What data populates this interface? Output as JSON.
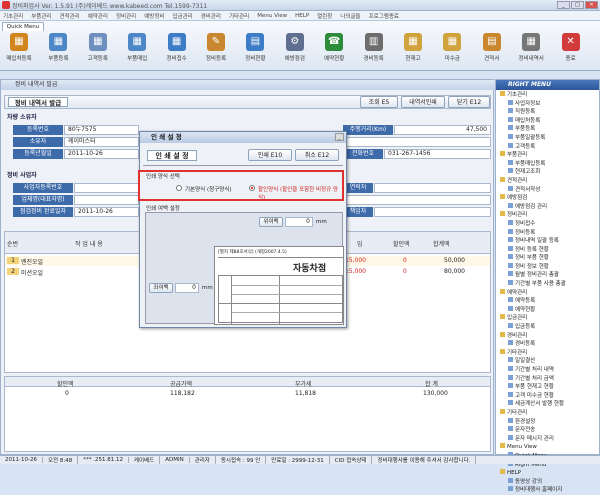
{
  "app": {
    "title": "정비파업사 Ver. 1.5.91  (주)케이베드 www.kabeed.com  Tel.1599-7311"
  },
  "menubar": [
    "기초관리",
    "부품관리",
    "견적관리",
    "예약관리",
    "정비관리",
    "예방정비",
    "입금관리",
    "경비관리",
    "기타관리",
    "Menu View",
    "HELP",
    "열린창",
    "나의글들",
    "프로그램종료"
  ],
  "quick_menu": {
    "tab": "Quick Menu",
    "tools": [
      {
        "label": "매입처등록",
        "color": "#d0851f",
        "icon": "▦"
      },
      {
        "label": "부품등록",
        "color": "#4d87c7",
        "icon": "▦"
      },
      {
        "label": "고객등록",
        "color": "#6f8fbf",
        "icon": "▦"
      },
      {
        "label": "부품매입",
        "color": "#4d87c7",
        "icon": "▦"
      },
      {
        "label": "정비접수",
        "color": "#3d7cc6",
        "icon": "▦"
      },
      {
        "label": "정비등록",
        "color": "#c9882f",
        "icon": "✎"
      },
      {
        "label": "정비현황",
        "color": "#3d7cc6",
        "icon": "▤"
      },
      {
        "label": "예방점검",
        "color": "#5f6f8f",
        "icon": "⚙"
      },
      {
        "label": "예약현황",
        "color": "#2d8c3a",
        "icon": "☎"
      },
      {
        "label": "경비등록",
        "color": "#6d6d6d",
        "icon": "▥"
      },
      {
        "label": "현재고",
        "color": "#d0a33f",
        "icon": "▦"
      },
      {
        "label": "미수금",
        "color": "#d0a33f",
        "icon": "▦"
      },
      {
        "label": "견적서",
        "color": "#c9882f",
        "icon": "▤"
      },
      {
        "label": "정비내역서",
        "color": "#777777",
        "icon": "▦"
      },
      {
        "label": "종료",
        "color": "#d23b3b",
        "icon": "✕"
      }
    ]
  },
  "panel": {
    "title": "정비 내역서 발급",
    "heading": "정비 내역서 발급",
    "btn_search": "조회 E5",
    "btn_print": "내역서인쇄",
    "btn_close": "닫기 E12"
  },
  "owner": {
    "section": "차량 소유자",
    "reg_label": "등록번호",
    "reg_value": "80누7575",
    "owner_label": "소유자",
    "owner_value": "케이마스터",
    "date_label": "등록년월일",
    "date_value": "2011-10-26",
    "mileage_label": "주행거리(Km)",
    "mileage_value": "47,500",
    "tel_label": "전화번호",
    "tel_value": "031-267-1456"
  },
  "biz": {
    "section": "정비 사업자",
    "bizno_label": "사업자등록번호",
    "ceo_label": "업체명(대표자명)",
    "done_label": "점검정비 완료일자",
    "done_value": "2011-10-26",
    "phone_label": "연락처",
    "resp_label": "책임자"
  },
  "table": {
    "headers": [
      "순번",
      "작 업 내 용",
      "",
      "임",
      "할인액",
      "합계액"
    ],
    "rows": [
      {
        "no": "1",
        "work": "엔진오일",
        "wage": "15,000",
        "disc": "0",
        "sum": "50,000"
      },
      {
        "no": "2",
        "work": "미션오일",
        "wage": "15,000",
        "disc": "0",
        "sum": "80,000"
      }
    ]
  },
  "totals": {
    "headers": [
      "할인액",
      "공급가액",
      "부가세",
      "합 계"
    ],
    "values": [
      "0",
      "118,182",
      "11,818",
      "130,000"
    ]
  },
  "dialog": {
    "title": "인 쇄 설 정",
    "heading": "인 쇄 설 정",
    "btn_print": "인쇄 E10",
    "btn_cancel": "취소 E12",
    "group1": "인쇄 양식 선택",
    "opt1": "기본양식 (청구양식)",
    "opt2": "할인양식 (할인을 포함한 비정규 양식)",
    "group2": "인쇄 여백 설정",
    "top_margin": "위여백",
    "top_value": "0",
    "left_margin": "좌여백",
    "left_value": "0",
    "unit": "mm",
    "doc_title": "자동차점",
    "form_no": "[별지 제88호서식] (개정2007.4.5)"
  },
  "right_menu": {
    "title": "RIGHT MENU",
    "items": [
      {
        "t": "g",
        "label": "기초관리"
      },
      {
        "t": "i",
        "label": "사업자정보"
      },
      {
        "t": "i",
        "label": "직원등록"
      },
      {
        "t": "i",
        "label": "매입처등록"
      },
      {
        "t": "i",
        "label": "부품등록"
      },
      {
        "t": "i",
        "label": "부품일괄등록"
      },
      {
        "t": "i",
        "label": "고객등록"
      },
      {
        "t": "g",
        "label": "부품관리"
      },
      {
        "t": "i",
        "label": "부품매입등록"
      },
      {
        "t": "i",
        "label": "현재고조회"
      },
      {
        "t": "g",
        "label": "견적관리"
      },
      {
        "t": "i",
        "label": "견적서작성"
      },
      {
        "t": "g",
        "label": "예방점검"
      },
      {
        "t": "i",
        "label": "예방점검 관리"
      },
      {
        "t": "g",
        "label": "정비관리"
      },
      {
        "t": "i",
        "label": "정비접수"
      },
      {
        "t": "i",
        "label": "정비등록"
      },
      {
        "t": "i",
        "label": "정비내역 일괄 등록"
      },
      {
        "t": "i",
        "label": "정비 등록 현황"
      },
      {
        "t": "i",
        "label": "정비 부품 현황"
      },
      {
        "t": "i",
        "label": "정비 정보 현황"
      },
      {
        "t": "i",
        "label": "월별 정비관리 총괄"
      },
      {
        "t": "i",
        "label": "기간별 부품 사용 총괄"
      },
      {
        "t": "g",
        "label": "예약관리"
      },
      {
        "t": "i",
        "label": "예약등록"
      },
      {
        "t": "i",
        "label": "예약현황"
      },
      {
        "t": "g",
        "label": "입금관리"
      },
      {
        "t": "i",
        "label": "입금등록"
      },
      {
        "t": "g",
        "label": "경비관리"
      },
      {
        "t": "i",
        "label": "경비등록"
      },
      {
        "t": "g",
        "label": "기타관리"
      },
      {
        "t": "i",
        "label": "일일결산"
      },
      {
        "t": "i",
        "label": "기간별 처리 내역"
      },
      {
        "t": "i",
        "label": "기간별 처리 금액"
      },
      {
        "t": "i",
        "label": "부품 현재고 현황"
      },
      {
        "t": "i",
        "label": "고객 미수금 현황"
      },
      {
        "t": "i",
        "label": "세금계산서 발행 현황"
      },
      {
        "t": "g",
        "label": "기타관리"
      },
      {
        "t": "i",
        "label": "환경설정"
      },
      {
        "t": "i",
        "label": "문자전송"
      },
      {
        "t": "i",
        "label": "문자 메시지 관리"
      },
      {
        "t": "g",
        "label": "Menu View"
      },
      {
        "t": "i",
        "label": "Quick Menu"
      },
      {
        "t": "i",
        "label": "Right Menu"
      },
      {
        "t": "g",
        "label": "HELP"
      },
      {
        "t": "i",
        "label": "동영상 강의"
      },
      {
        "t": "i",
        "label": "정비대행사 홈페이지"
      }
    ]
  },
  "status": [
    "2011-10-26",
    "오전 8:48",
    "*** .251.81.12",
    "케이베드",
    "ADMIN",
    "관리자",
    "동시접속 : 99 인",
    "만료일 : 2999-12-31",
    "CID 접속상태",
    "정비대행사를 이용해 주셔서 감사합니다."
  ]
}
